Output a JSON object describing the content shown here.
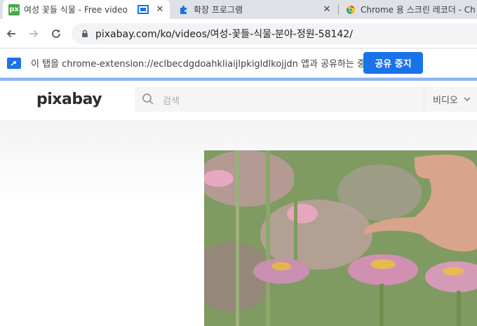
{
  "tabs": [
    {
      "title": "여성 꽃들 식물 - Free video",
      "favicon": "pixabay-favicon-icon",
      "favicon_text": "px",
      "active": true
    },
    {
      "title": "확장 프로그램",
      "favicon": "puzzle-icon",
      "active": false
    },
    {
      "title": "Chrome 용 스크린 레코더 - Ch",
      "favicon": "chrome-webstore-icon",
      "active": false
    }
  ],
  "omnibox": {
    "url": "pixabay.com/ko/videos/여성-꽃들-식물-분야-정원-58142/"
  },
  "infobar": {
    "message": "이 탭을 chrome-extension://eclbecdgdoahkliaijlpkigldlkojjdn 앱과 공유하는 중",
    "button": "공유 중지"
  },
  "site": {
    "logo": "pixabay",
    "search_placeholder": "검색",
    "media_type": "비디오"
  },
  "colors": {
    "accent": "#1a73e8",
    "share_bar": "#8ab4f8",
    "pixabay_green": "#48a947"
  }
}
